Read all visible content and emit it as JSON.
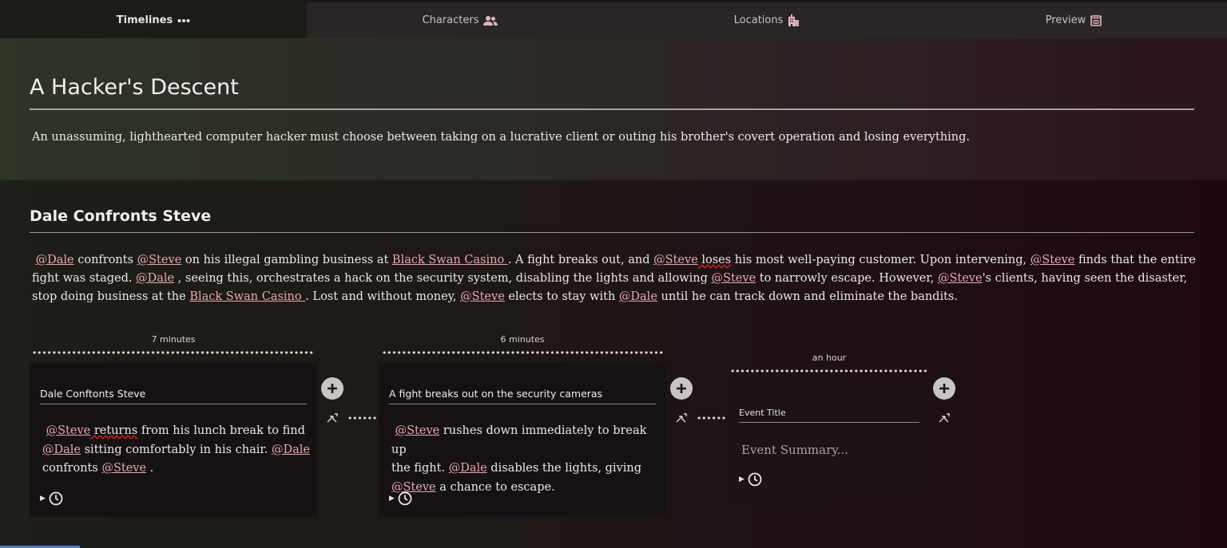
{
  "tabs": [
    {
      "label": "Timelines",
      "icon": "ellipsis-icon",
      "active": true
    },
    {
      "label": "Characters",
      "icon": "users-icon",
      "active": false
    },
    {
      "label": "Locations",
      "icon": "buildings-icon",
      "active": false
    },
    {
      "label": "Preview",
      "icon": "preview-icon",
      "active": false
    }
  ],
  "story": {
    "title": "A Hacker's Descent",
    "logline": "An unassuming, lighthearted computer hacker must choose between taking on a lucrative client or outing his brother's covert operation and losing everything."
  },
  "scene": {
    "title": "Dale Confronts Steve",
    "summary_parts": {
      "p1": "@Dale",
      "p2": " confronts ",
      "p3": "@Steve",
      "p4": " on his illegal gambling business at ",
      "p5": "Black Swan Casino ",
      "p6": ".  A fight breaks out, and ",
      "p7": "@Steve",
      "p8": " loses",
      "p9": " his most well-paying customer.  Upon intervening, ",
      "p10": "@Steve",
      "p11": " finds that the entire fight was staged.  ",
      "p12": "@Dale",
      "p13": " , seeing this, orchestrates a hack on the security system, disabling the lights and allowing ",
      "p14": "@Steve",
      "p15": " to narrowly escape.  However, ",
      "p16": "@Steve",
      "p17": "'s clients, having seen the disaster, stop doing business at the ",
      "p18": "Black Swan Casino ",
      "p19": ".  Lost and without money, ",
      "p20": "@Steve",
      "p21": " elects to stay with ",
      "p22": "@Dale",
      "p23": " until he can track down and eliminate the bandits."
    }
  },
  "events": [
    {
      "duration": "7 minutes",
      "title": "Dale Conftonts Steve",
      "body": {
        "m1": "@Steve",
        "t1": " returns",
        "t2": " from his lunch break to find",
        "m2": "@Dale",
        "t3": " sitting comfortably in his chair.   ",
        "m3": "@Dale",
        "t4": "confronts  ",
        "m4": "@Steve",
        "t5": " ."
      }
    },
    {
      "duration": "6 minutes",
      "title": "A fight breaks out on the security cameras",
      "body": {
        "m1": "@Steve",
        "t1": " rushes down immediately to break up",
        "t2": "the fight.   ",
        "m2": "@Dale",
        "t3": " disables the lights, giving",
        "m3": "@Steve",
        "t4": " a chance to escape."
      }
    },
    {
      "duration": "an hour",
      "title_placeholder": "Event Title",
      "summary_placeholder": "Event Summary..."
    }
  ],
  "colors": {
    "mention": "#e9a9b3",
    "active_tab": "#1b1c18",
    "accent_strip": "#4a7cc7"
  }
}
